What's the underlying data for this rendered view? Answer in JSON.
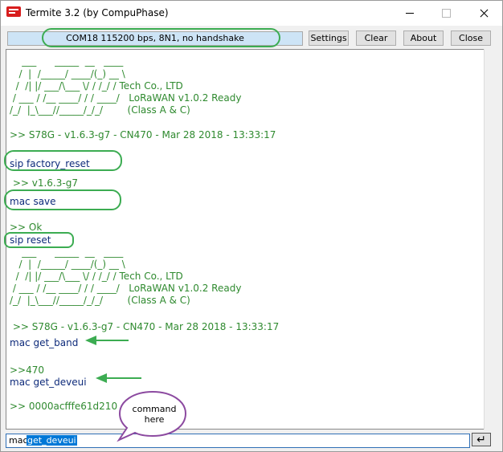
{
  "window": {
    "title": "Termite 3.2 (by CompuPhase)"
  },
  "toolbar": {
    "status": "COM18 115200 bps, 8N1, no handshake",
    "buttons": [
      "Settings",
      "Clear",
      "About",
      "Close"
    ]
  },
  "terminal": {
    "lines": [
      {
        "text": "    ___      _____  __   ____",
        "kind": "out"
      },
      {
        "text": "   /  |  /_____/ ____/(_) __ \\",
        "kind": "out"
      },
      {
        "text": "  /  /| |/ ___/\\___ \\/ / /_/ / Tech Co., LTD",
        "kind": "out"
      },
      {
        "text": " / ___ / /__ ____/ / / ____/   LoRaWAN v1.0.2 Ready",
        "kind": "out"
      },
      {
        "text": "/_/  |_\\___//_____/_/_/        (Class A & C)",
        "kind": "out"
      },
      {
        "text": "",
        "kind": "out"
      },
      {
        "text": ">> S78G - v1.6.3-g7 - CN470 - Mar 28 2018 - 13:33:17",
        "kind": "out"
      },
      {
        "text": "",
        "kind": "out"
      },
      {
        "text": "sip factory_reset",
        "kind": "cmd"
      },
      {
        "text": " >> v1.6.3-g7",
        "kind": "out"
      },
      {
        "text": "mac save",
        "kind": "cmd"
      },
      {
        "text": "",
        "kind": "out"
      },
      {
        "text": ">> Ok",
        "kind": "out"
      },
      {
        "text": "sip reset",
        "kind": "cmd"
      },
      {
        "text": "    ___      _____  __   ____",
        "kind": "out"
      },
      {
        "text": "   /  |  /_____/ ____/(_) __ \\",
        "kind": "out"
      },
      {
        "text": "  /  /| |/ ___/\\___ \\/ / /_/ / Tech Co., LTD",
        "kind": "out"
      },
      {
        "text": " / ___ / /__ ____/ / / ____/   LoRaWAN v1.0.2 Ready",
        "kind": "out"
      },
      {
        "text": "/_/  |_\\___//_____/_/_/        (Class A & C)",
        "kind": "out"
      },
      {
        "text": "",
        "kind": "out"
      },
      {
        "text": " >> S78G - v1.6.3-g7 - CN470 - Mar 28 2018 - 13:33:17",
        "kind": "out"
      },
      {
        "text": "mac get_band",
        "kind": "cmd"
      },
      {
        "text": "",
        "kind": "out"
      },
      {
        "text": ">>470",
        "kind": "out"
      },
      {
        "text": "mac get_deveui",
        "kind": "cmd"
      },
      {
        "text": "",
        "kind": "out"
      },
      {
        "text": ">> 0000acfffe61d210",
        "kind": "out"
      }
    ]
  },
  "input": {
    "prefix": "mac",
    "selected": "get_deveui"
  },
  "send_button": {
    "icon": "enter-icon",
    "glyph": "↵"
  },
  "annotation": {
    "bubble": [
      "command",
      "here"
    ],
    "color": "#3cac52",
    "bubble_color": "#8c4aa0"
  }
}
